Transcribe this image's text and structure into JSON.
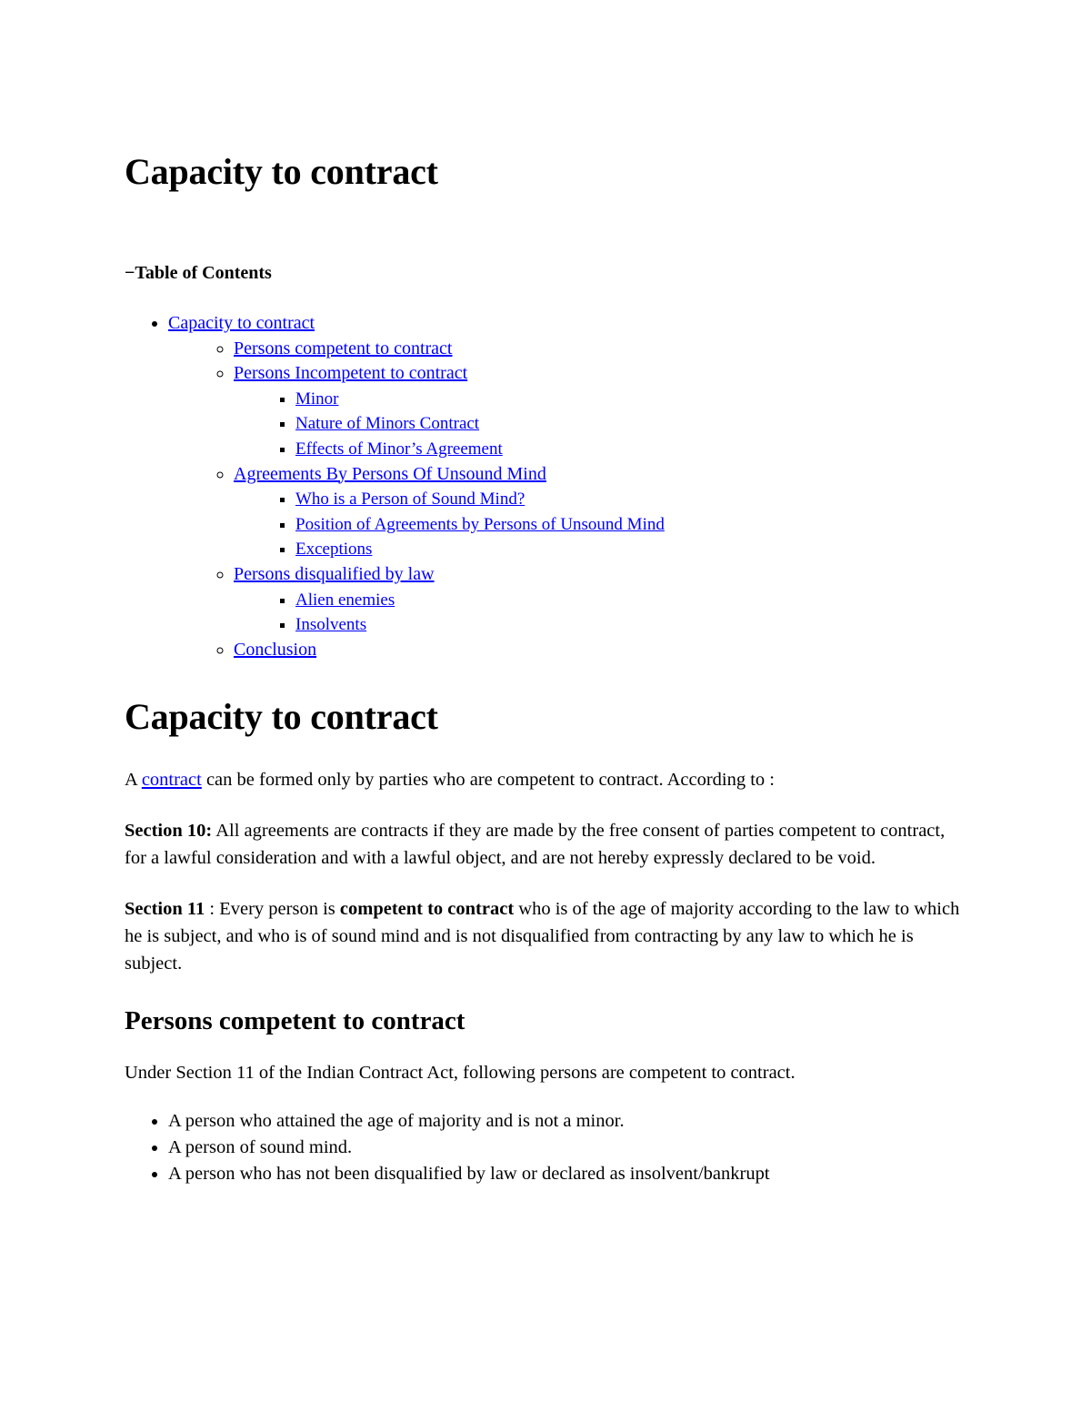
{
  "document": {
    "title": "Capacity to contract"
  },
  "toc": {
    "toggle_symbol": "−",
    "heading": "Table of Contents",
    "items": [
      {
        "label": "Capacity to contract",
        "children": [
          {
            "label": "Persons competent to contract",
            "children": []
          },
          {
            "label": "Persons Incompetent to contract",
            "children": [
              {
                "label": "Minor"
              },
              {
                "label": "Nature of Minors Contract"
              },
              {
                "label": "Effects of Minor’s Agreement"
              }
            ]
          },
          {
            "label": "Agreements By Persons Of Unsound Mind",
            "children": [
              {
                "label": "Who is a Person of Sound Mind?"
              },
              {
                "label": "Position of Agreements by Persons of Unsound Mind"
              },
              {
                "label": "Exceptions"
              }
            ]
          },
          {
            "label": "Persons disqualified by law",
            "children": [
              {
                "label": "Alien enemies"
              },
              {
                "label": "Insolvents"
              }
            ]
          },
          {
            "label": "Conclusion",
            "children": []
          }
        ]
      }
    ]
  },
  "main": {
    "heading": "Capacity to contract",
    "intro": {
      "before_link": "A ",
      "link_text": "contract",
      "after_link": " can be formed only by parties who are competent to contract. According to :"
    },
    "section10": {
      "label": "Section 10:",
      "text": " All agreements are contracts if they are made by the free consent of parties competent to contract, for a lawful consideration and with a lawful object, and are not hereby expressly declared to be void."
    },
    "section11": {
      "label": "Section 11",
      "lead": " : Every person is ",
      "emphasis": "competent to contract",
      "text": " who is of the age of majority according to the law to which he is subject, and who is of sound mind and is not disqualified from contracting by any law to which he is subject."
    },
    "competent": {
      "heading": "Persons competent to contract",
      "intro": "Under Section 11 of the Indian Contract Act, following persons are competent to contract.",
      "items": [
        "A person who attained the age of majority and is not a minor.",
        "A person of sound mind.",
        "A person who has not been disqualified by law or declared as insolvent/bankrupt"
      ]
    }
  },
  "colors": {
    "link": "#0000ff",
    "text": "#000000",
    "background": "#ffffff"
  }
}
